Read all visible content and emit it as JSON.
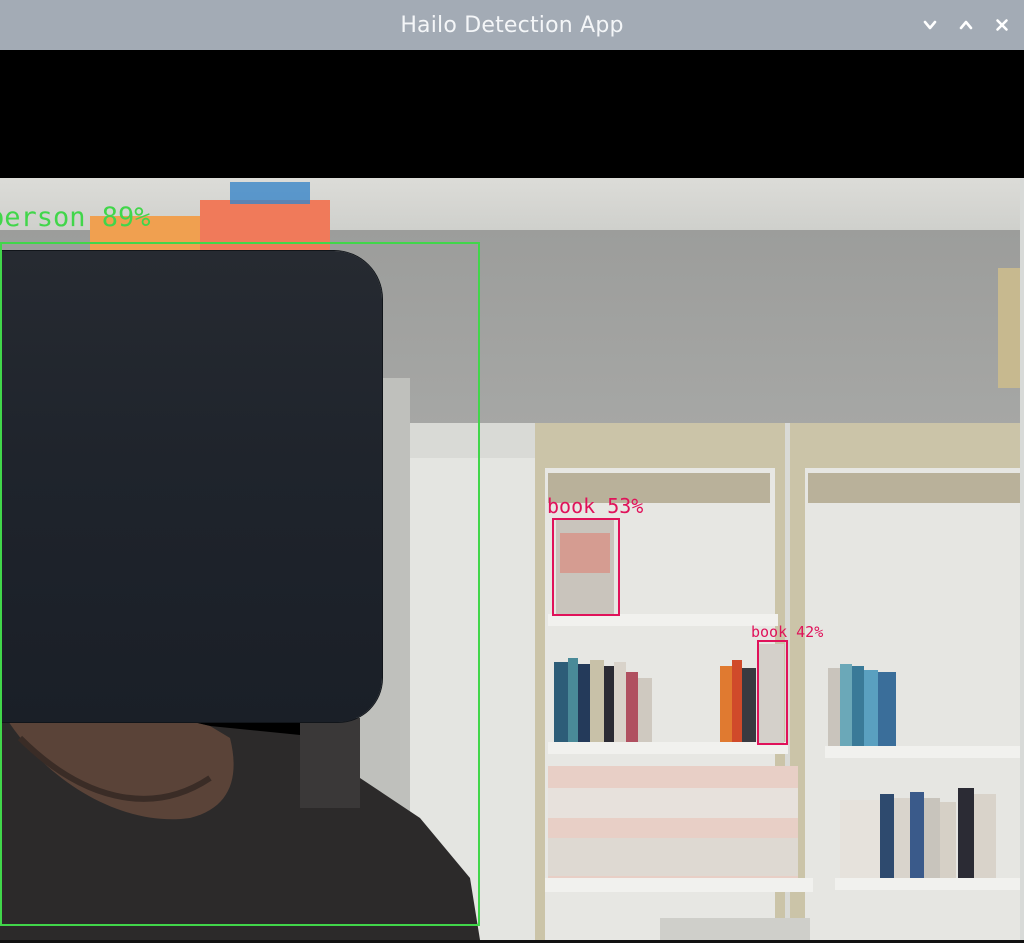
{
  "window": {
    "title": "Hailo Detection App",
    "controls": [
      {
        "name": "minimize-button",
        "icon": "chevron-down-icon"
      },
      {
        "name": "maximize-button",
        "icon": "chevron-up-icon"
      },
      {
        "name": "close-button",
        "icon": "close-icon"
      }
    ]
  },
  "detections": [
    {
      "class": "person",
      "label": "person 89%",
      "color": "#41d64a"
    },
    {
      "class": "book",
      "label": "book 53%",
      "color": "#e0125a"
    },
    {
      "class": "book",
      "label": "book 42%",
      "color": "#e0125a"
    }
  ]
}
